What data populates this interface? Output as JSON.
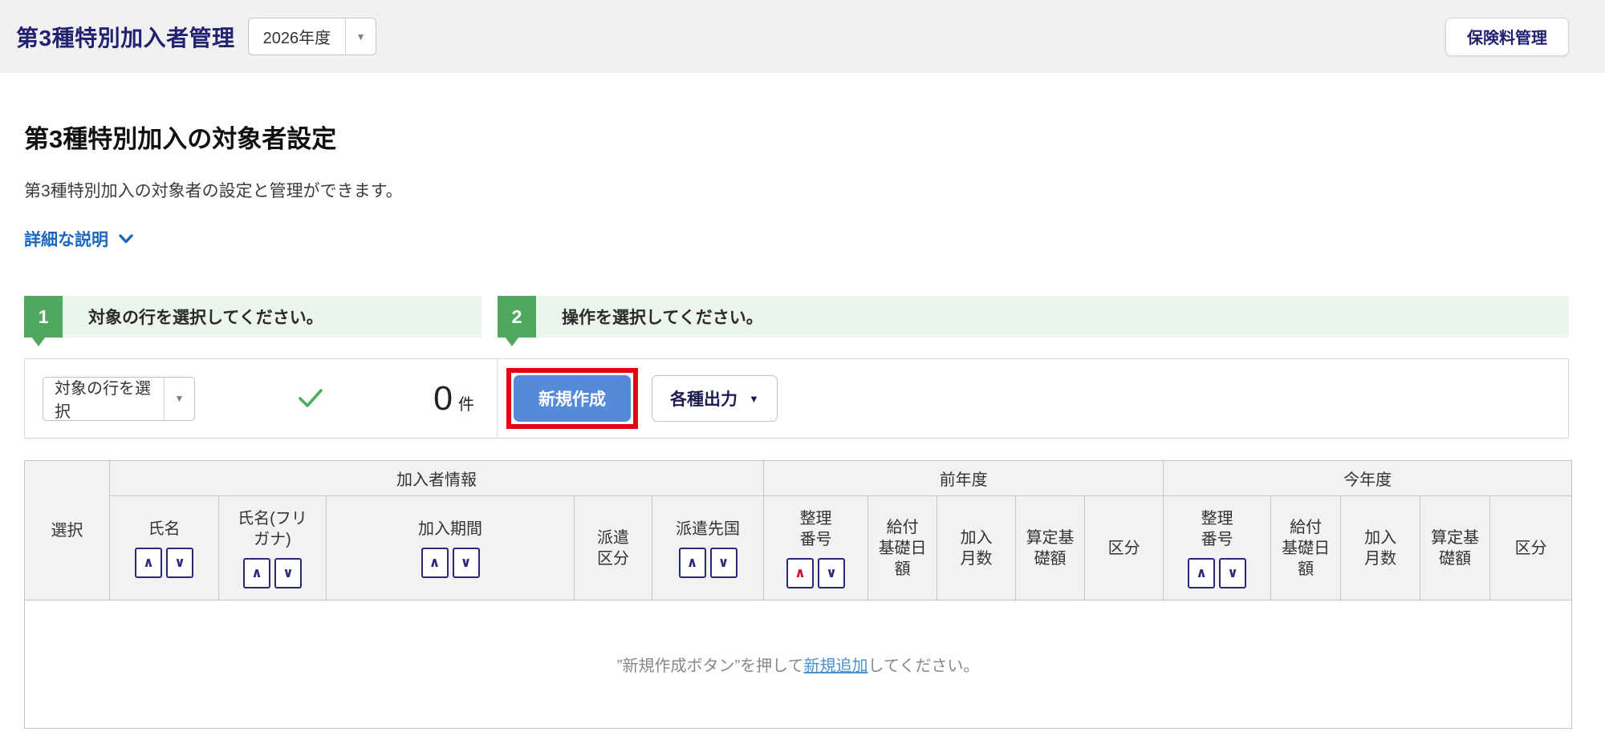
{
  "header": {
    "title": "第3種特別加入者管理",
    "year_select": {
      "value": "2026年度"
    },
    "premium_button_label": "保険料管理"
  },
  "page": {
    "heading": "第3種特別加入の対象者設定",
    "description": "第3種特別加入の対象者の設定と管理ができます。",
    "detail_link_label": "詳細な説明"
  },
  "steps": [
    {
      "number": "1",
      "text": "対象の行を選択してください。"
    },
    {
      "number": "2",
      "text": "操作を選択してください。"
    }
  ],
  "toolbar": {
    "row_select": {
      "value": "対象の行を選択"
    },
    "count_value": "0",
    "count_unit": "件",
    "create_button_label": "新規作成",
    "export_button_label": "各種出力"
  },
  "table": {
    "groups": [
      {
        "label": "加入者情報"
      },
      {
        "label": "前年度"
      },
      {
        "label": "今年度"
      }
    ],
    "columns": [
      {
        "label": "選択",
        "sort": false
      },
      {
        "label": "氏名",
        "sort": true
      },
      {
        "label": "氏名(フリ\nガナ)",
        "sort": true
      },
      {
        "label": "加入期間",
        "sort": true
      },
      {
        "label": "派遣\n区分",
        "sort": false
      },
      {
        "label": "派遣先国",
        "sort": true
      },
      {
        "label": "整理\n番号",
        "sort": true,
        "sort_active": "asc"
      },
      {
        "label": "給付\n基礎日額",
        "sort": false
      },
      {
        "label": "加入\n月数",
        "sort": false
      },
      {
        "label": "算定基\n礎額",
        "sort": false
      },
      {
        "label": "区分",
        "sort": false
      },
      {
        "label": "整理\n番号",
        "sort": true
      },
      {
        "label": "給付\n基礎日額",
        "sort": false
      },
      {
        "label": "加入\n月数",
        "sort": false
      },
      {
        "label": "算定基\n礎額",
        "sort": false
      },
      {
        "label": "区分",
        "sort": false
      }
    ],
    "empty_state": {
      "prefix": "”新規作成ボタン”を押して",
      "link": "新規追加",
      "suffix": "してください。"
    }
  },
  "icons": {
    "sort_asc": "∧",
    "sort_desc": "∨",
    "caret_down": "▼"
  },
  "colors": {
    "navy_text": "#232270",
    "link_blue": "#1a66c2",
    "primary_button_blue": "#548ad8",
    "annotation_red": "#e60012",
    "step_green": "#4ea95e",
    "step_bg_green": "#ebf5eb",
    "check_green": "#4bae5c",
    "sort_active_red": "#cf0a2c",
    "header_band_gray": "#f1f1f2",
    "table_header_gray": "#f2f2f2"
  }
}
